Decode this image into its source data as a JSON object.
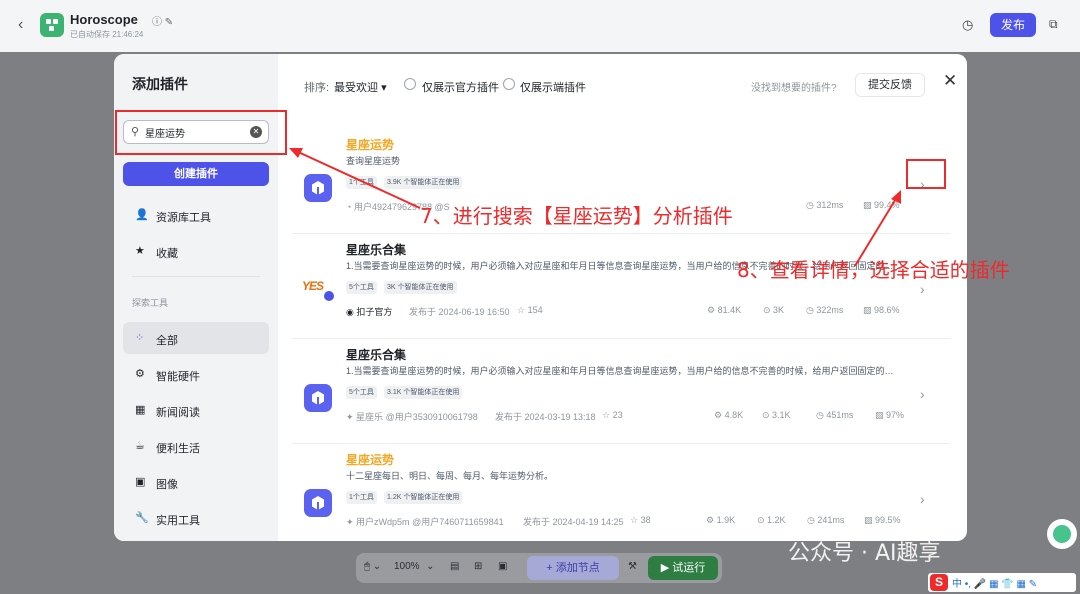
{
  "app": {
    "title": "Horoscope",
    "title_icons": "ⓘ ✎",
    "autosave": "已自动保存 21:46:24",
    "publish_label": "发布"
  },
  "bottom_toolbar": {
    "zoom": "100%",
    "add_node_label": "添加节点",
    "test_run_label": "试运行"
  },
  "modal": {
    "title": "添加插件",
    "search_value": "星座运势",
    "create_label": "创建插件",
    "sidebar_top": [
      {
        "label": "资源库工具",
        "icon": "person-icon"
      },
      {
        "label": "收藏",
        "icon": "star-icon"
      }
    ],
    "section_label": "探索工具",
    "categories": [
      {
        "label": "全部",
        "icon": "grid-icon",
        "active": true
      },
      {
        "label": "智能硬件",
        "icon": "chip-icon"
      },
      {
        "label": "新闻阅读",
        "icon": "news-icon"
      },
      {
        "label": "便利生活",
        "icon": "cup-icon"
      },
      {
        "label": "图像",
        "icon": "image-icon"
      },
      {
        "label": "实用工具",
        "icon": "wrench-icon"
      }
    ],
    "filters": {
      "sort_label": "排序:",
      "sort_value": "最受欢迎",
      "official_only": "仅展示官方插件",
      "edge_only": "仅展示端插件",
      "no_plugin_text": "没找到想要的插件?",
      "feedback_label": "提交反馈"
    },
    "plugins": [
      {
        "name": "星座运势",
        "highlight": true,
        "desc": "查询星座运势",
        "tags": [
          "1个工具",
          "3.9K 个智能体正在使用"
        ],
        "author": "用户492479629788",
        "handle": "@S",
        "published": "",
        "favorites": "",
        "stats": [
          "312ms",
          "99.4%"
        ]
      },
      {
        "name": "星座乐合集",
        "highlight": false,
        "desc": "1.当需要查询星座运势的时候，用户必须输入对应星座和年月日等信息查询星座运势，当用户给的信息不完善的时候，给用户返回固定的…",
        "tags": [
          "5个工具",
          "3K 个智能体正在使用"
        ],
        "author": "扣子官方",
        "handle": "",
        "published": "发布于 2024-06-19 16:50",
        "favorites": "154",
        "stats": [
          "81.4K",
          "3K",
          "322ms",
          "98.6%"
        ]
      },
      {
        "name": "星座乐合集",
        "highlight": false,
        "desc": "1.当需要查询星座运势的时候，用户必须输入对应星座和年月日等信息查询星座运势，当用户给的信息不完善的时候，给用户返回固定的…",
        "tags": [
          "5个工具",
          "3.1K 个智能体正在使用"
        ],
        "author": "星座乐",
        "handle": "@用户3530910061798",
        "published": "发布于 2024-03-19 13:18",
        "favorites": "23",
        "stats": [
          "4.8K",
          "3.1K",
          "451ms",
          "97%"
        ]
      },
      {
        "name": "星座运势",
        "highlight": true,
        "desc": "十二星座每日、明日、每周、每月、每年运势分析。",
        "tags": [
          "1个工具",
          "1.2K 个智能体正在使用"
        ],
        "author": "用户zWdp5m",
        "handle": "@用户7460711659841",
        "published": "发布于 2024-04-19 14:25",
        "favorites": "38",
        "stats": [
          "1.9K",
          "1.2K",
          "241ms",
          "99.5%"
        ]
      }
    ]
  },
  "annotations": {
    "step7": "7、进行搜索【星座运势】分析插件",
    "step8": "8、查看详情，选择合适的插件",
    "color": "#ee2a2a"
  },
  "watermark": "公众号 · AI趣享",
  "ime": {
    "logo": "S",
    "items": "中 •, 🎤 ▦ 👕 ▦ ✎"
  }
}
